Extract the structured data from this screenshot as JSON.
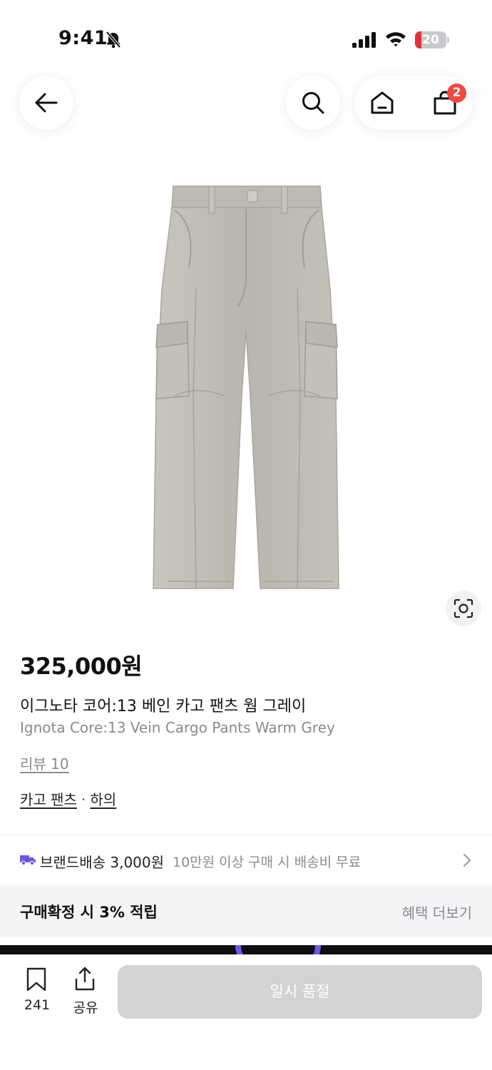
{
  "status_bar": {
    "time": "9:41",
    "battery_level": "20",
    "battery_fraction": 0.2,
    "battery_color": "#e5303a",
    "icons": [
      "bell-slash-icon",
      "signal-icon",
      "wifi-icon",
      "battery-icon"
    ]
  },
  "nav": {
    "back_icon": "arrow-left-icon",
    "search_icon": "search-icon",
    "home_icon": "home-icon",
    "cart_icon": "shopping-bag-icon",
    "cart_count": "2",
    "badge_color": "#f0493e"
  },
  "product": {
    "image": "grey-cargo-pants",
    "lens_icon": "visual-search-icon",
    "price": "325,000원",
    "name_ko": "이그노타 코어:13 베인 카고 팬츠 웜 그레이",
    "name_en": "Ignota Core:13 Vein Cargo Pants Warm Grey",
    "review_link": "리뷰 10",
    "categories": [
      "카고 팬츠",
      "하의"
    ],
    "category_separator": "·"
  },
  "shipping": {
    "icon": "truck-icon",
    "icon_color": "#6b57e8",
    "label": "브랜드배송 3,000원",
    "note": "10만원 이상 구매 시 배송비 무료"
  },
  "points": {
    "label": "구매확정 시 3% 적립",
    "more": "혜택 더보기"
  },
  "bottom_bar": {
    "bookmark_count": "241",
    "share_label": "공유",
    "cta_label": "일시 품절",
    "cta_color": "#d3d3d6"
  }
}
